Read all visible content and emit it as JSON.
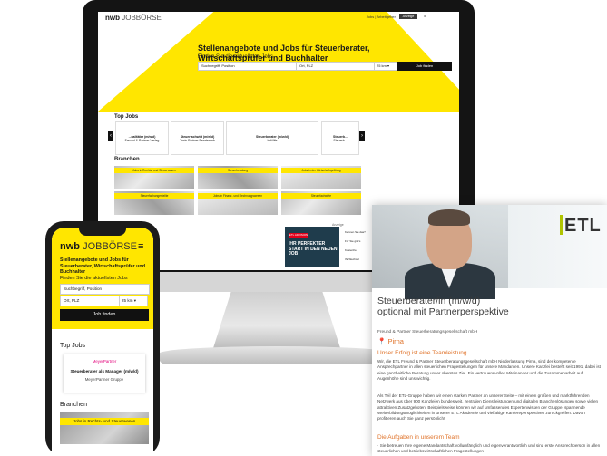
{
  "desktop": {
    "logo_bold": "nwb",
    "logo_light": "JOBBÖRSE",
    "nav_jobs": "Jobs",
    "nav_sep": "|",
    "nav_arbeitgeber": "Arbeitgeber",
    "nav_button": "Anzeige schalten",
    "nav_menu_icon": "≡",
    "title": "Stellenangebote und Jobs für Steuerberater, Wirtschaftsprüfer und Buchhalter",
    "subtitle": "Finden Sie die aktuellsten Jobs",
    "search_placeholder": "Suchbegriff, Position",
    "location_placeholder": "Ort, PLZ",
    "radius": "25 km",
    "search_button": "Job finden",
    "top_jobs_heading": "Top Jobs",
    "top_jobs": [
      {
        "title": "...ualitäter (m/w/d)",
        "company": "Freund & Partner Verlag"
      },
      {
        "title": "Steuerfachwirt (m/w/d)",
        "company": "Taxis Partner Berater mb"
      },
      {
        "title": "Steuerberater (m/w/d)",
        "company": "ImWife"
      },
      {
        "title": "Steuerb...",
        "company": "Steuerb..."
      }
    ],
    "branchen_heading": "Branchen",
    "branchen": [
      "Jobs in Rechts- und Steuerwesen",
      "Steuerberatung",
      "Jobs in der Wirtschaftsprüfung",
      "Steuerfachangestellte",
      "Jobs in Finanz- und Rechnungswesen",
      "Steuerfachwirte"
    ],
    "ad_label": "Anzeige",
    "ad_badge": "ETL ADVISION",
    "ad_text": "IHR PERFEKTER START IN DEN NEUEN JOB",
    "ad_items": [
      "Kennen Sie das?",
      "Für Sie gibt's",
      "Kostenfrei",
      "Ihr Wechsel"
    ]
  },
  "phone": {
    "logo_bold": "nwb",
    "logo_light": "JOBBÖRSE",
    "menu_icon": "≡",
    "title": "Stellenangebote und Jobs für Steuerberater, Wirtschaftsprüfer und Buchhalter",
    "subtitle": "Finden Sie die aktuellsten Jobs",
    "search_placeholder": "Suchbegriff, Position",
    "location_placeholder": "Ort, PLZ",
    "radius": "25 km",
    "search_button": "Job finden",
    "top_jobs_heading": "Top Jobs",
    "card_logo": "MeyerPartner",
    "card_title": "Steuerberater als Manager (m/w/d)",
    "card_company": "MeyerPartner Gruppe",
    "branchen_heading": "Branchen",
    "tile_label": "Jobs in Rechts- und Steuerwesen"
  },
  "job": {
    "brand": "ETL",
    "title_line1": "Steuerberater/in (m/w/d)",
    "title_line2": "optional mit Partnerperspektive",
    "company": "Freund & Partner Steuerberatungsgesellschaft mbH",
    "location_icon": "📍",
    "location": "Pirna",
    "h1": "Unser Erfolg ist eine Teamleistung",
    "p1": "Wir, die ETL Freund & Partner Steuerberatungsgesellschaft mbH Niederlassung Pirna, sind der kompetente Ansprechpartner in allen steuerlichen Fragestellungen für unsere Mandanten. Unsere Kanzlei besteht seit 1991, dabei ist eine ganzheitliche Beratung unser oberstes Ziel. Ein vertrauensvolles Miteinander und die Zusammenarbeit auf Augenhöhe sind uns wichtig.",
    "p2": "Als Teil der ETL-Gruppe haben wir einen starken Partner an unserer Seite – mit einem großen und marktführenden Netzwerk aus über 900 Kanzleien bundesweit, zentralen Dienstleistungen und digitalen Branchenlösungen sowie vielen attraktiven Zusatzgeboten. Beispielsweise können wir auf umfassendes Expertenwissen der Gruppe, spannende Weiterbildungsmöglichkeiten in unserer ETL Akademie und vielfältige Karriereperspektiven zurückgreifen. Davon profitieren auch Sie ganz persönlich!",
    "h2": "Die Aufgaben in unserem Team",
    "p3": "· Sie betreuen Ihre eigene Mandantschaft vollumfänglich und eigenverantwortlich und sind erste Ansprechperson in allen steuerlichen und betriebswirtschaftlichen Fragestellungen"
  },
  "colors": {
    "brand_yellow": "#ffe600",
    "accent_orange": "#e0732a",
    "etl_green": "#b0c400"
  }
}
